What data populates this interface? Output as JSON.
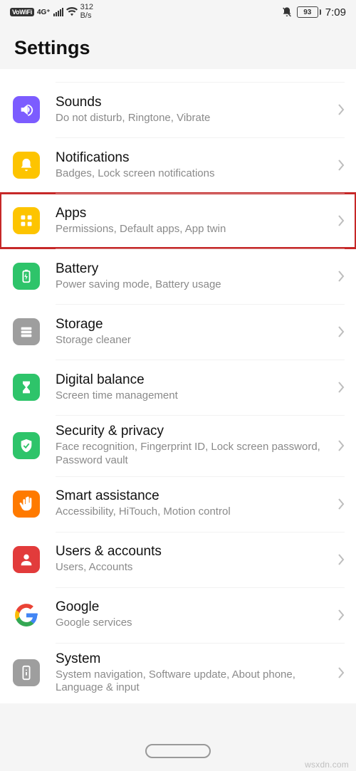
{
  "status": {
    "vowifi": "VoWiFi",
    "data_gen": "4G⁺",
    "speed_top": "312",
    "speed_bottom": "B/s",
    "battery": "93",
    "time": "7:09"
  },
  "header": {
    "title": "Settings"
  },
  "rows": [
    {
      "title": "Sounds",
      "subtitle": "Do not disturb, Ringtone, Vibrate",
      "icon": "sounds-icon",
      "bg": "#7c5cff",
      "highlight": false
    },
    {
      "title": "Notifications",
      "subtitle": "Badges, Lock screen notifications",
      "icon": "bell-icon",
      "bg": "#fdc400",
      "highlight": false
    },
    {
      "title": "Apps",
      "subtitle": "Permissions, Default apps, App twin",
      "icon": "apps-icon",
      "bg": "#fdc400",
      "highlight": true
    },
    {
      "title": "Battery",
      "subtitle": "Power saving mode, Battery usage",
      "icon": "battery-icon",
      "bg": "#2ec46a",
      "highlight": false
    },
    {
      "title": "Storage",
      "subtitle": "Storage cleaner",
      "icon": "storage-icon",
      "bg": "#9e9e9e",
      "highlight": false
    },
    {
      "title": "Digital balance",
      "subtitle": "Screen time management",
      "icon": "hourglass-icon",
      "bg": "#2ec46a",
      "highlight": false
    },
    {
      "title": "Security & privacy",
      "subtitle": "Face recognition, Fingerprint ID, Lock screen password, Password vault",
      "icon": "shield-icon",
      "bg": "#2ec46a",
      "highlight": false
    },
    {
      "title": "Smart assistance",
      "subtitle": "Accessibility, HiTouch, Motion control",
      "icon": "hand-icon",
      "bg": "#ff7a00",
      "highlight": false
    },
    {
      "title": "Users & accounts",
      "subtitle": "Users, Accounts",
      "icon": "user-icon",
      "bg": "#e23b3b",
      "highlight": false
    },
    {
      "title": "Google",
      "subtitle": "Google services",
      "icon": "google-icon",
      "bg": "#ffffff",
      "highlight": false
    },
    {
      "title": "System",
      "subtitle": "System navigation, Software update, About phone, Language & input",
      "icon": "device-icon",
      "bg": "#9e9e9e",
      "highlight": false
    }
  ],
  "watermark": "wsxdn.com"
}
